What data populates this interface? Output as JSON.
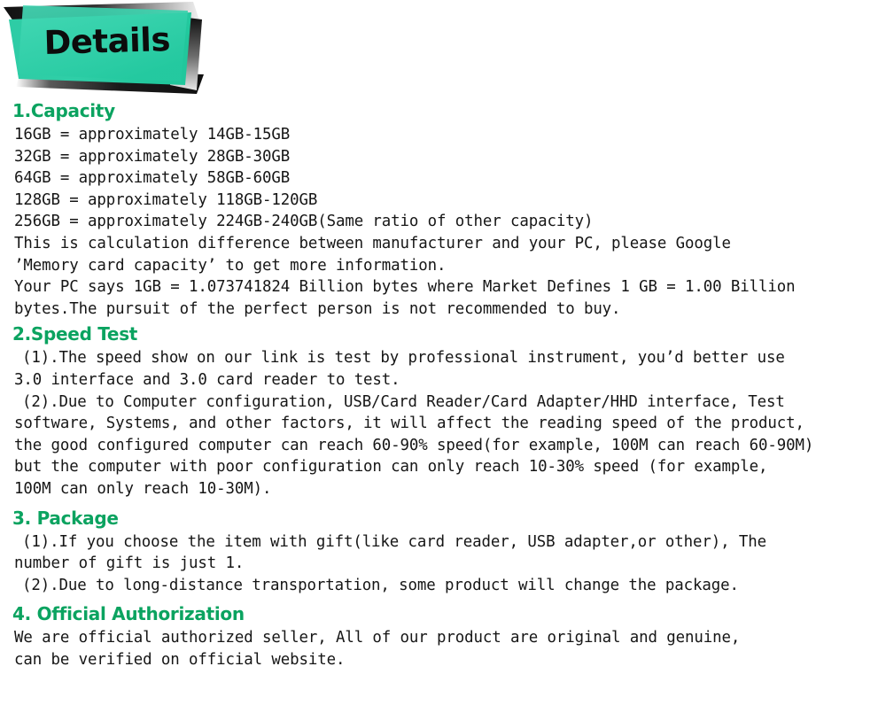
{
  "banner": {
    "title": "Details",
    "teal": "#2ECCA5",
    "teal_light": "#3FD6B0",
    "dark": "#1c1c1c"
  },
  "theme": {
    "heading_green": "#0BA360",
    "body_text": "#161616",
    "background": "#FFFFFF"
  },
  "sections": [
    {
      "heading": "1.Capacity",
      "lines": [
        {
          "text": "16GB = approximately 14GB-15GB",
          "indent": 0
        },
        {
          "text": "32GB = approximately 28GB-30GB",
          "indent": 0
        },
        {
          "text": "64GB = approximately 58GB-60GB",
          "indent": 0
        },
        {
          "text": "128GB = approximately 118GB-120GB",
          "indent": 0
        },
        {
          "text": "256GB = approximately 224GB-240GB(Same ratio of other capacity)",
          "indent": 0
        },
        {
          "text": "This is calculation difference between manufacturer and your PC, please Google",
          "indent": 0
        },
        {
          "text": "’Memory card capacity’ to get more information.",
          "indent": 0
        },
        {
          "text": "Your PC says 1GB = 1.073741824 Billion bytes where Market Defines 1 GB = 1.00 Billion",
          "indent": 0
        },
        {
          "text": "bytes.The pursuit of the perfect person is not recommended to buy.",
          "indent": 0
        }
      ]
    },
    {
      "heading": "2.Speed Test",
      "lines": [
        {
          "text": "(1).The speed show on our link is test by professional instrument, you’d better use",
          "indent": 1
        },
        {
          "text": "3.0 interface and 3.0 card reader to test.",
          "indent": 0
        },
        {
          "text": "(2).Due to Computer configuration, USB/Card Reader/Card Adapter/HHD interface, Test",
          "indent": 1
        },
        {
          "text": "software, Systems, and other factors, it will affect the reading speed of the product,",
          "indent": 0
        },
        {
          "text": "the good configured computer can reach 60-90% speed(for example, 100M can reach 60-90M)",
          "indent": 0
        },
        {
          "text": "but the computer with poor configuration can only reach 10-30% speed (for example,",
          "indent": 0
        },
        {
          "text": "100M can only reach 10-30M).",
          "indent": 0
        }
      ]
    },
    {
      "heading": "3. Package",
      "lines": [
        {
          "text": "(1).If you choose the item with gift(like card reader, USB adapter,or other), The",
          "indent": 1
        },
        {
          "text": "number of gift is just 1.",
          "indent": 0
        },
        {
          "text": "(2).Due to long-distance transportation, some product will change the package.",
          "indent": 1
        }
      ]
    },
    {
      "heading": "4. Official Authorization",
      "lines": [
        {
          "text": "We are official authorized seller, All of our product are original and genuine,",
          "indent": 0
        },
        {
          "text": "can be verified on official website.",
          "indent": 0
        }
      ]
    }
  ]
}
